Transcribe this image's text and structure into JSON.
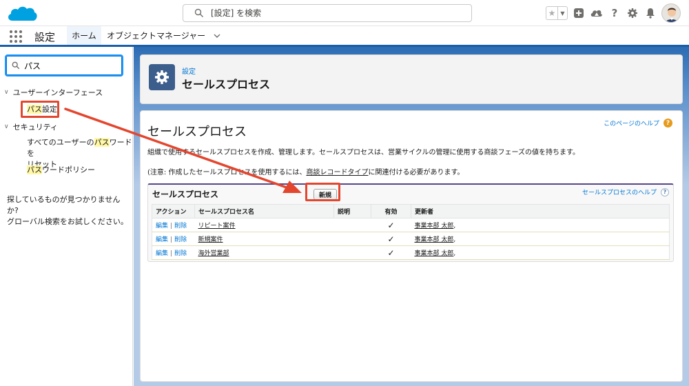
{
  "header": {
    "search_placeholder": "[設定] を検索",
    "icons": [
      "favorites-star-icon",
      "add-icon",
      "trailhead-icon",
      "help-icon",
      "setup-gear-icon",
      "notification-bell-icon",
      "user-avatar"
    ]
  },
  "nav": {
    "app_name": "設定",
    "tabs": [
      {
        "label": "ホーム",
        "active": true
      },
      {
        "label": "オブジェクトマネージャー",
        "has_dropdown": true
      }
    ]
  },
  "sidebar": {
    "quick_find_value": "パス",
    "groups": [
      {
        "label": "ユーザーインターフェース",
        "items": [
          {
            "before": "",
            "highlight": "パス",
            "after": "設定"
          }
        ]
      },
      {
        "label": "セキュリティ",
        "items": [
          {
            "line1_before": "すべてのユーザーの",
            "line1_highlight": "パス",
            "line1_after": "ワードを",
            "line2": "リセット"
          },
          {
            "before": "",
            "highlight": "パス",
            "after": "ワードポリシー"
          }
        ]
      }
    ],
    "not_found_line1": "探しているものが見つかりませんか?",
    "not_found_line2": "グローバル検索をお試しください。"
  },
  "page_header": {
    "breadcrumb": "設定",
    "title": "セールスプロセス"
  },
  "content": {
    "title": "セールスプロセス",
    "help_link": "このページのヘルプ",
    "description": "組織で使用するセールスプロセスを作成、管理します。セールスプロセスは、営業サイクルの管理に使用する商談フェーズの値を持ちます。",
    "note_before": "(注意: 作成したセールスプロセスを使用するには、",
    "note_link": "商談レコードタイプ",
    "note_after": "に関連付ける必要があります。"
  },
  "related_list": {
    "title": "セールスプロセス",
    "new_button": "新規",
    "help_link": "セールスプロセスのヘルプ",
    "columns": [
      "アクション",
      "セールスプロセス名",
      "説明",
      "有効",
      "更新者"
    ],
    "rows": [
      {
        "edit": "編集",
        "sep": "|",
        "del": "削除",
        "name": "リピート案件",
        "description": "",
        "active": "✓",
        "modified_by": "事業本部 太郎",
        "suffix": ","
      },
      {
        "edit": "編集",
        "sep": "|",
        "del": "削除",
        "name": "新規案件",
        "description": "",
        "active": "✓",
        "modified_by": "事業本部 太郎",
        "suffix": ","
      },
      {
        "edit": "編集",
        "sep": "|",
        "del": "削除",
        "name": "海外営業部",
        "description": "",
        "active": "✓",
        "modified_by": "事業本部 太郎",
        "suffix": ","
      }
    ]
  },
  "colors": {
    "brand_blue": "#0176d3",
    "nav_underline": "#1b5ea8",
    "annotation_red": "#e3462e",
    "highlight_yellow": "#fff8a8",
    "gear_tile": "#3c5e8d"
  }
}
